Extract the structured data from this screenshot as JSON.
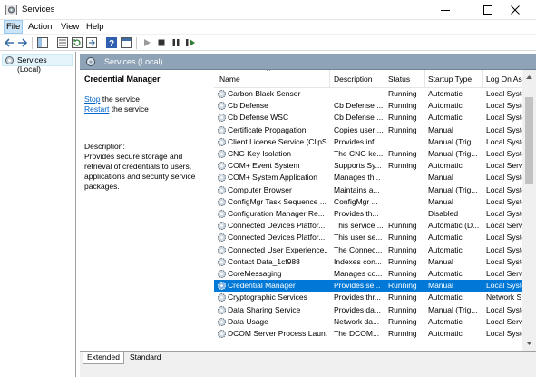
{
  "window": {
    "title": "Services"
  },
  "menu": [
    "File",
    "Action",
    "View",
    "Help"
  ],
  "toolbar": {
    "icons": [
      "back-icon",
      "forward-icon",
      "show-tree-icon",
      "properties-icon",
      "refresh-icon",
      "export-icon",
      "help-icon",
      "console-icon",
      "start-icon",
      "stop-icon",
      "pause-icon",
      "restart-icon"
    ]
  },
  "tree": {
    "root": "Services (Local)"
  },
  "pane": {
    "title": "Services (Local)"
  },
  "detail": {
    "service_name": "Credential Manager",
    "stop_link": "Stop",
    "stop_rest": " the service",
    "restart_link": "Restart",
    "restart_rest": " the service",
    "description_label": "Description:",
    "description_text": "Provides secure storage and retrieval of credentials to users, applications and security service packages."
  },
  "columns": [
    "Name",
    "Description",
    "Status",
    "Startup Type",
    "Log On As"
  ],
  "services": [
    {
      "name": "Carbon Black Sensor",
      "description": "",
      "status": "Running",
      "startup": "Automatic",
      "logon": "Local Syste"
    },
    {
      "name": "Cb Defense",
      "description": "Cb Defense ...",
      "status": "Running",
      "startup": "Automatic",
      "logon": "Local Syste"
    },
    {
      "name": "Cb Defense WSC",
      "description": "Cb Defense ...",
      "status": "Running",
      "startup": "Automatic",
      "logon": "Local Syste"
    },
    {
      "name": "Certificate Propagation",
      "description": "Copies user ...",
      "status": "Running",
      "startup": "Manual",
      "logon": "Local Syste"
    },
    {
      "name": "Client License Service (ClipS...",
      "description": "Provides inf...",
      "status": "",
      "startup": "Manual (Trig...",
      "logon": "Local Syste"
    },
    {
      "name": "CNG Key Isolation",
      "description": "The CNG ke...",
      "status": "Running",
      "startup": "Manual (Trig...",
      "logon": "Local Syste"
    },
    {
      "name": "COM+ Event System",
      "description": "Supports Sy...",
      "status": "Running",
      "startup": "Automatic",
      "logon": "Local Servic"
    },
    {
      "name": "COM+ System Application",
      "description": "Manages th...",
      "status": "",
      "startup": "Manual",
      "logon": "Local Syste"
    },
    {
      "name": "Computer Browser",
      "description": "Maintains a...",
      "status": "",
      "startup": "Manual (Trig...",
      "logon": "Local Syste"
    },
    {
      "name": "ConfigMgr Task Sequence ...",
      "description": "ConfigMgr ...",
      "status": "",
      "startup": "Manual",
      "logon": "Local Syste"
    },
    {
      "name": "Configuration Manager Re...",
      "description": "Provides th...",
      "status": "",
      "startup": "Disabled",
      "logon": "Local Syste"
    },
    {
      "name": "Connected Devices Platfor...",
      "description": "This service ...",
      "status": "Running",
      "startup": "Automatic (D...",
      "logon": "Local Servic"
    },
    {
      "name": "Connected Devices Platfor...",
      "description": "This user se...",
      "status": "Running",
      "startup": "Automatic",
      "logon": "Local Syste"
    },
    {
      "name": "Connected User Experience...",
      "description": "The Connec...",
      "status": "Running",
      "startup": "Automatic",
      "logon": "Local Syste"
    },
    {
      "name": "Contact Data_1cf988",
      "description": "Indexes con...",
      "status": "Running",
      "startup": "Manual",
      "logon": "Local Syste"
    },
    {
      "name": "CoreMessaging",
      "description": "Manages co...",
      "status": "Running",
      "startup": "Automatic",
      "logon": "Local Servic"
    },
    {
      "name": "Credential Manager",
      "description": "Provides se...",
      "status": "Running",
      "startup": "Manual",
      "logon": "Local Syste",
      "selected": true
    },
    {
      "name": "Cryptographic Services",
      "description": "Provides thr...",
      "status": "Running",
      "startup": "Automatic",
      "logon": "Network S..."
    },
    {
      "name": "Data Sharing Service",
      "description": "Provides da...",
      "status": "Running",
      "startup": "Manual (Trig...",
      "logon": "Local Syste"
    },
    {
      "name": "Data Usage",
      "description": "Network da...",
      "status": "Running",
      "startup": "Automatic",
      "logon": "Local Servic"
    },
    {
      "name": "DCOM Server Process Laun...",
      "description": "The DCOM...",
      "status": "Running",
      "startup": "Automatic",
      "logon": "Local Syste"
    }
  ],
  "scrollbar": {
    "position": 0.08
  },
  "tabs": [
    "Extended",
    "Standard"
  ],
  "colors": {
    "selection": "#0078d7",
    "pane_header": "#8fa3b6",
    "link": "#0066cc"
  }
}
